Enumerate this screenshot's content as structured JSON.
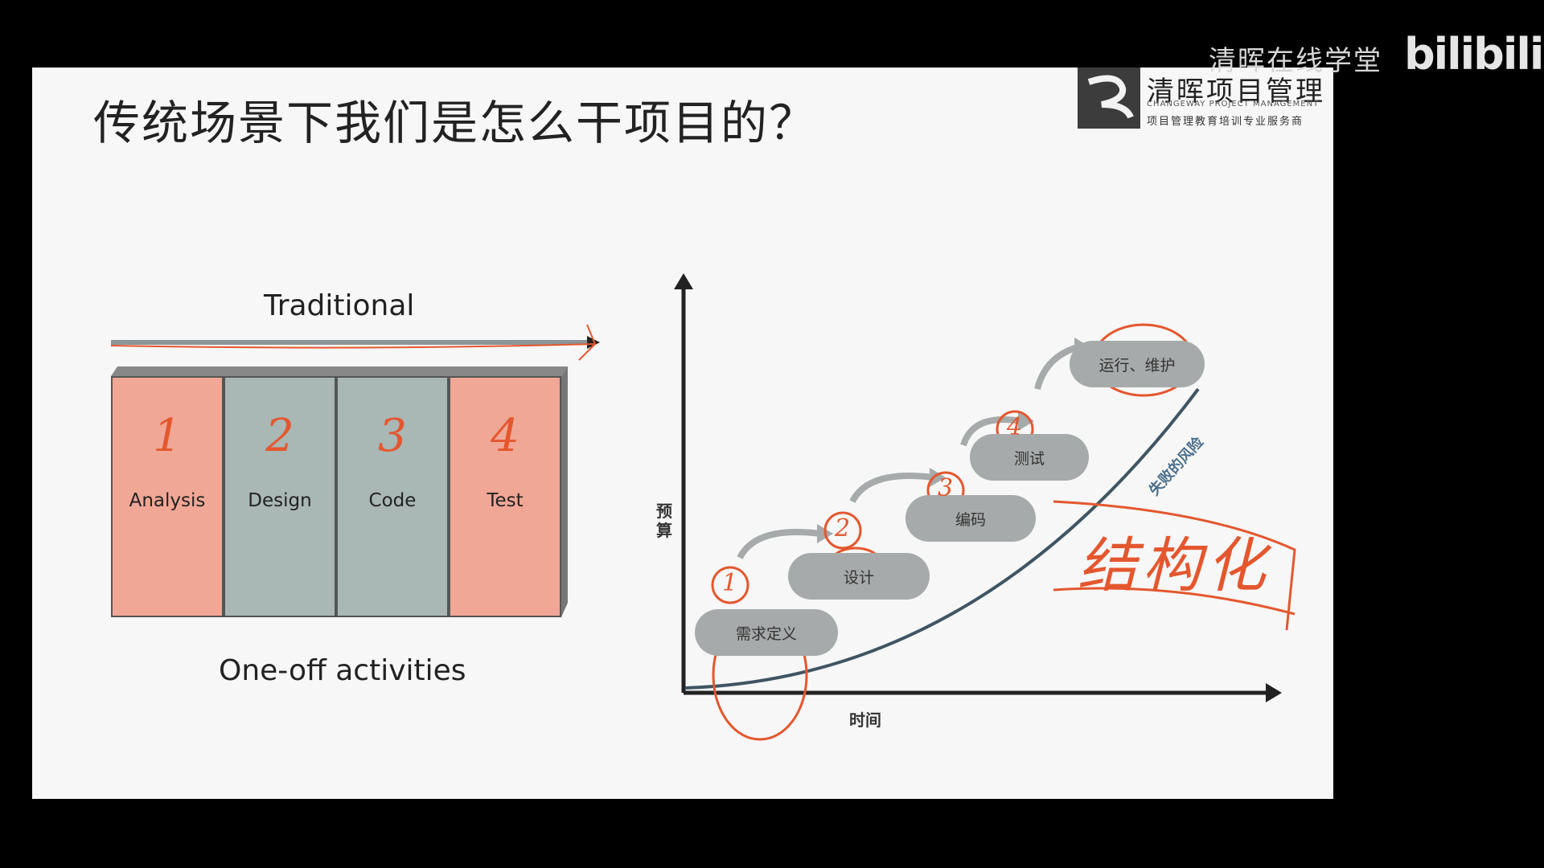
{
  "slide": {
    "title": "传统场景下我们是怎么干项目的？",
    "logo": {
      "name": "清晖项目管理",
      "english": "CHANGEWAY PROJECT MANAGEMENT",
      "tagline": "项目管理教育培训专业服务商"
    }
  },
  "watermark": {
    "channel": "清晖在线学堂",
    "platform": "bilibili"
  },
  "traditional": {
    "label": "Traditional",
    "footer": "One-off activities",
    "phases": [
      {
        "label": "Analysis",
        "number": "1",
        "color": "#f0a795"
      },
      {
        "label": "Design",
        "number": "2",
        "color": "#a9b7b5"
      },
      {
        "label": "Code",
        "number": "3",
        "color": "#a9b7b5"
      },
      {
        "label": "Test",
        "number": "4",
        "color": "#f0a795"
      }
    ]
  },
  "waterfall": {
    "y_axis_label": "预算",
    "x_axis_label": "时间",
    "risk_label": "失败的风险",
    "stages": [
      {
        "label": "需求定义",
        "number": "1"
      },
      {
        "label": "设计",
        "number": "2"
      },
      {
        "label": "编码",
        "number": "3"
      },
      {
        "label": "测试",
        "number": "4"
      },
      {
        "label": "运行、维护",
        "number": ""
      }
    ],
    "handwritten_note": "结构化"
  },
  "colors": {
    "annotation": "#e4572e",
    "stage_fill": "#a6aaaa",
    "curve": "#3f5563"
  }
}
